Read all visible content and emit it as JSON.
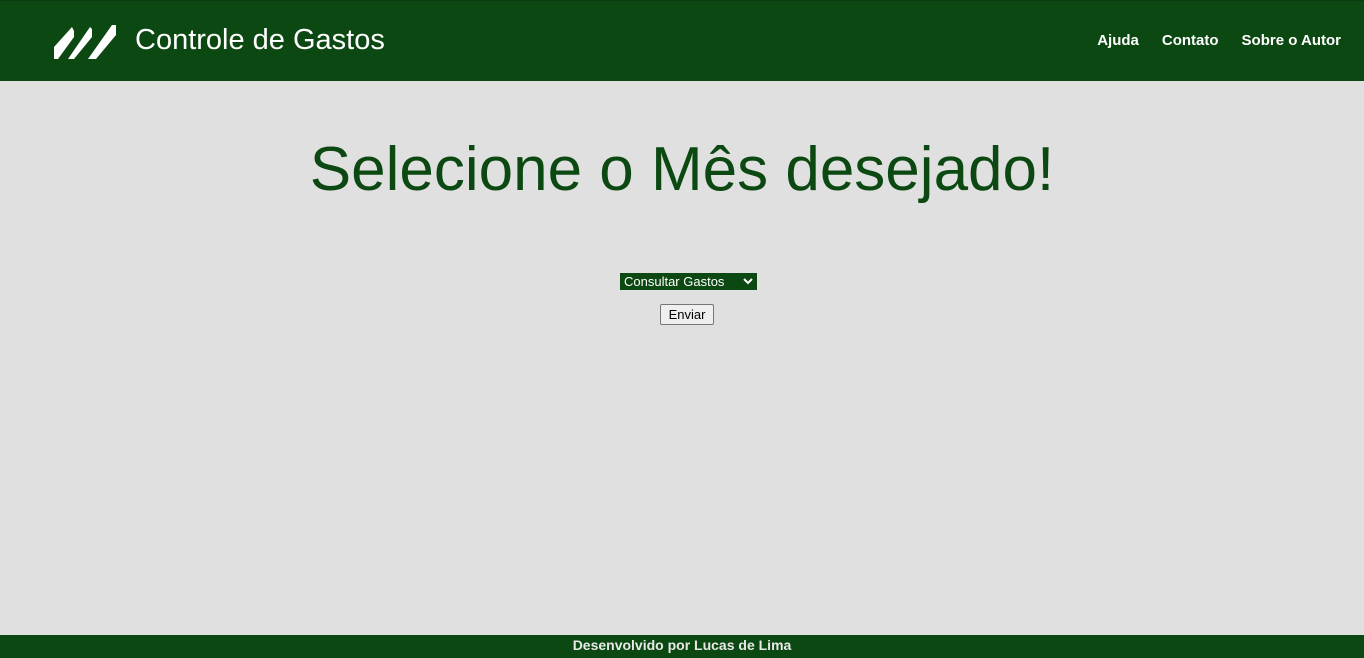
{
  "header": {
    "title": "Controle de Gastos",
    "logo_icon": "triple-slash-logo-icon",
    "nav": [
      {
        "label": "Ajuda"
      },
      {
        "label": "Contato"
      },
      {
        "label": "Sobre o Autor"
      }
    ]
  },
  "main": {
    "heading": "Selecione o Mês desejado!",
    "month_select": {
      "selected": "Consultar Gastos",
      "icon": "chevron-down-icon"
    },
    "submit_label": "Enviar"
  },
  "footer": {
    "text": "Desenvolvido por Lucas de Lima"
  },
  "colors": {
    "brand_green": "#0c4812",
    "background": "#e0e0e0"
  }
}
